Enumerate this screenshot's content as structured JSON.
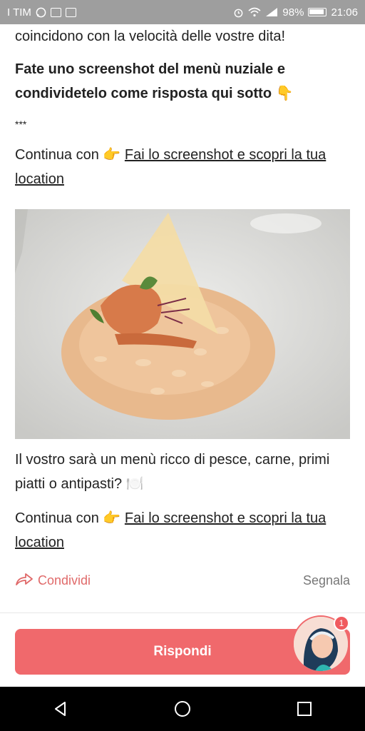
{
  "status": {
    "carrier": "I TIM",
    "battery": "98%",
    "time": "21:06"
  },
  "post": {
    "line1": "coincidono con la velocità delle vostre dita!",
    "bold_text": "Fate uno screenshot del menù nuziale e condividetelo come risposta qui sotto 👇",
    "separator": "***",
    "continue_prefix_1": "Continua con 👉 ",
    "continue_link_1": "Fai lo screenshot e scopri la tua location",
    "question": "Il vostro sarà un menù ricco di pesce, carne, primi piatti o antipasti? 🍽️",
    "continue_prefix_2": "Continua con 👉 ",
    "continue_link_2": "Fai lo screenshot e scopri la tua location"
  },
  "actions": {
    "share_label": "Condividi",
    "report_label": "Segnala"
  },
  "reply": {
    "button_label": "Rispondi",
    "badge_count": "1"
  },
  "colors": {
    "accent": "#f0696c",
    "share": "#e06a6a"
  }
}
